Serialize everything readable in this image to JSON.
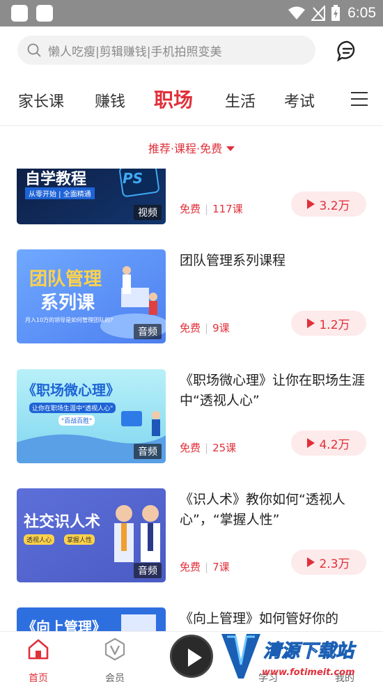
{
  "status_bar": {
    "time": "6:05"
  },
  "search": {
    "placeholder": "懒人吃瘦|剪辑赚钱|手机拍照变美"
  },
  "tabs": [
    {
      "label": "家长课",
      "active": false
    },
    {
      "label": "赚钱",
      "active": false
    },
    {
      "label": "职场",
      "active": true
    },
    {
      "label": "生活",
      "active": false
    },
    {
      "label": "考试",
      "active": false
    }
  ],
  "filter": {
    "label": "推荐·课程·免费"
  },
  "courses": [
    {
      "thumb_text": "自学教程",
      "thumb_sub": "从零开始 | 全面精通",
      "thumb_badge_text": "PS",
      "media": "视频",
      "title": "",
      "price": "免费",
      "lessons": "117课",
      "plays": "3.2万"
    },
    {
      "thumb_text": "团队管理",
      "thumb_text2": "系列课",
      "thumb_sub": "月入10万的领导是如何管理团队的?",
      "media": "音频",
      "title": "团队管理系列课程",
      "price": "免费",
      "lessons": "9课",
      "plays": "1.2万"
    },
    {
      "thumb_text": "《职场微心理》",
      "thumb_sub": "让你在职场生涯中\"透视人心\"",
      "thumb_sub2": "\"百战百胜\"",
      "media": "音频",
      "title": "《职场微心理》让你在职场生涯中“透视人心”",
      "price": "免费",
      "lessons": "25课",
      "plays": "4.2万"
    },
    {
      "thumb_text": "社交识人术",
      "thumb_tag1": "透视人心",
      "thumb_tag2": "掌握人性",
      "media": "音频",
      "title": "《识人术》教你如何“透视人心”，“掌握人性”",
      "price": "免费",
      "lessons": "7课",
      "plays": "2.3万"
    },
    {
      "thumb_text": "《向上管理》",
      "media": "",
      "title": "《向上管理》如何管好你的",
      "price": "",
      "lessons": "",
      "plays": ""
    }
  ],
  "bottom_nav": [
    {
      "label": "首页",
      "icon": "home-icon",
      "active": true
    },
    {
      "label": "会员",
      "icon": "vip-icon",
      "active": false
    },
    {
      "label": "学习",
      "icon": "study-icon",
      "active": false
    },
    {
      "label": "我的",
      "icon": "profile-icon",
      "active": false
    }
  ],
  "watermark": {
    "text": "清源下载站",
    "url": "www.fotimeit.com"
  },
  "colors": {
    "accent": "#e0303a",
    "accent_light": "#fdeaea",
    "status_bar": "#8c8c8c"
  }
}
